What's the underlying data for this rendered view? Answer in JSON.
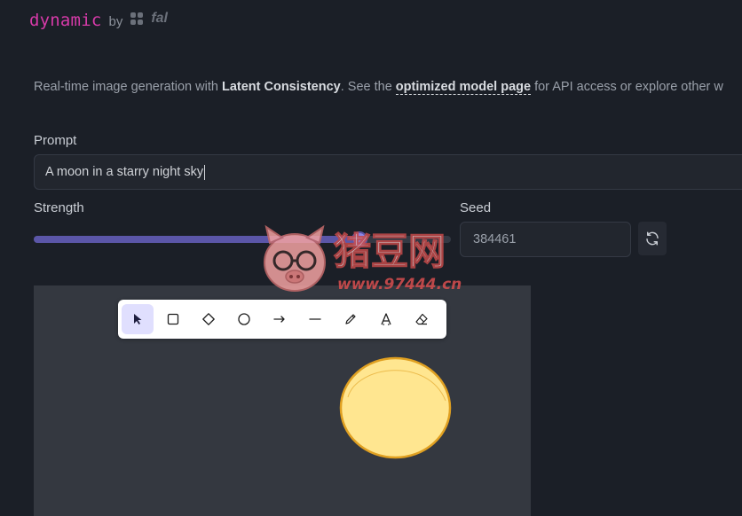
{
  "header": {
    "brand_name": "dynamic",
    "brand_by": "by",
    "partner_logo_text": "fal"
  },
  "description": {
    "text_1": "Real-time image generation with ",
    "bold_1": "Latent Consistency",
    "text_2": ". See the ",
    "link": "optimized model page",
    "text_3": " for API access or explore other w"
  },
  "prompt": {
    "label": "Prompt",
    "value": "A moon in a starry night sky"
  },
  "strength": {
    "label": "Strength",
    "value_fraction": 0.78
  },
  "seed": {
    "label": "Seed",
    "value": "384461"
  },
  "toolbar": {
    "tools": [
      "selection-icon",
      "rectangle-icon",
      "diamond-icon",
      "ellipse-icon",
      "arrow-icon",
      "line-icon",
      "pencil-icon",
      "text-icon",
      "eraser-icon"
    ],
    "active_tool": "selection-icon"
  },
  "watermark": {
    "text": "猪豆网",
    "url": "www.97444.cn"
  },
  "colors": {
    "background": "#1b1f27",
    "brand": "#d63aa8",
    "slider_fill": "#5b56a8",
    "moon_fill": "#ffe690",
    "moon_stroke": "#e0a021"
  }
}
